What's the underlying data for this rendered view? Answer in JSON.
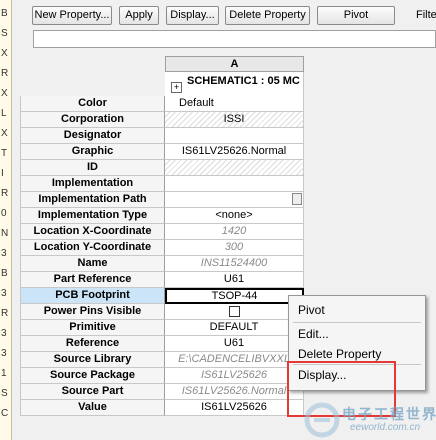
{
  "gutter_chars": [
    "B",
    "S",
    "X",
    "R",
    "X",
    "L",
    "X",
    "T",
    "I",
    "R",
    "0",
    "N",
    "3",
    "B",
    "3",
    "R",
    "3",
    "3",
    "1",
    "S",
    "C"
  ],
  "toolbar": {
    "new_property": "New Property...",
    "apply": "Apply",
    "display": "Display...",
    "delete_property": "Delete Property",
    "pivot": "Pivot",
    "filter_label": "Filter b"
  },
  "grid": {
    "column_header": "A",
    "schematic_label": "SCHEMATIC1 : 05 MC",
    "rows": [
      {
        "label": "Color",
        "value": "Default",
        "style": "left"
      },
      {
        "label": "Corporation",
        "value": "ISSI",
        "style": "hatch"
      },
      {
        "label": "Designator",
        "value": "",
        "style": "plain"
      },
      {
        "label": "Graphic",
        "value": "IS61LV25626.Normal",
        "style": "plain"
      },
      {
        "label": "ID",
        "value": "",
        "style": "hatch"
      },
      {
        "label": "Implementation",
        "value": "",
        "style": "plain"
      },
      {
        "label": "Implementation Path",
        "value": "",
        "style": "dots"
      },
      {
        "label": "Implementation Type",
        "value": "<none>",
        "style": "plain"
      },
      {
        "label": "Location X-Coordinate",
        "value": "1420",
        "style": "gray"
      },
      {
        "label": "Location Y-Coordinate",
        "value": "300",
        "style": "gray"
      },
      {
        "label": "Name",
        "value": "INS11524400",
        "style": "gray"
      },
      {
        "label": "Part Reference",
        "value": "U61",
        "style": "plain"
      },
      {
        "label": "PCB Footprint",
        "value": "TSOP-44",
        "style": "active"
      },
      {
        "label": "Power Pins Visible",
        "value": "",
        "style": "checkbox"
      },
      {
        "label": "Primitive",
        "value": "DEFAULT",
        "style": "plain"
      },
      {
        "label": "Reference",
        "value": "U61",
        "style": "plain"
      },
      {
        "label": "Source Library",
        "value": "E:\\CADENCELIBVXXL",
        "style": "gray"
      },
      {
        "label": "Source Package",
        "value": "IS61LV25626",
        "style": "gray"
      },
      {
        "label": "Source Part",
        "value": "IS61LV25626.Normal",
        "style": "gray"
      },
      {
        "label": "Value",
        "value": "IS61LV25626",
        "style": "plain"
      }
    ]
  },
  "context_menu": {
    "items": [
      "Pivot",
      "Edit...",
      "Delete Property",
      "Display..."
    ]
  },
  "watermark": {
    "text": "电子工程世界",
    "sub": "eeworld.com.cn"
  }
}
